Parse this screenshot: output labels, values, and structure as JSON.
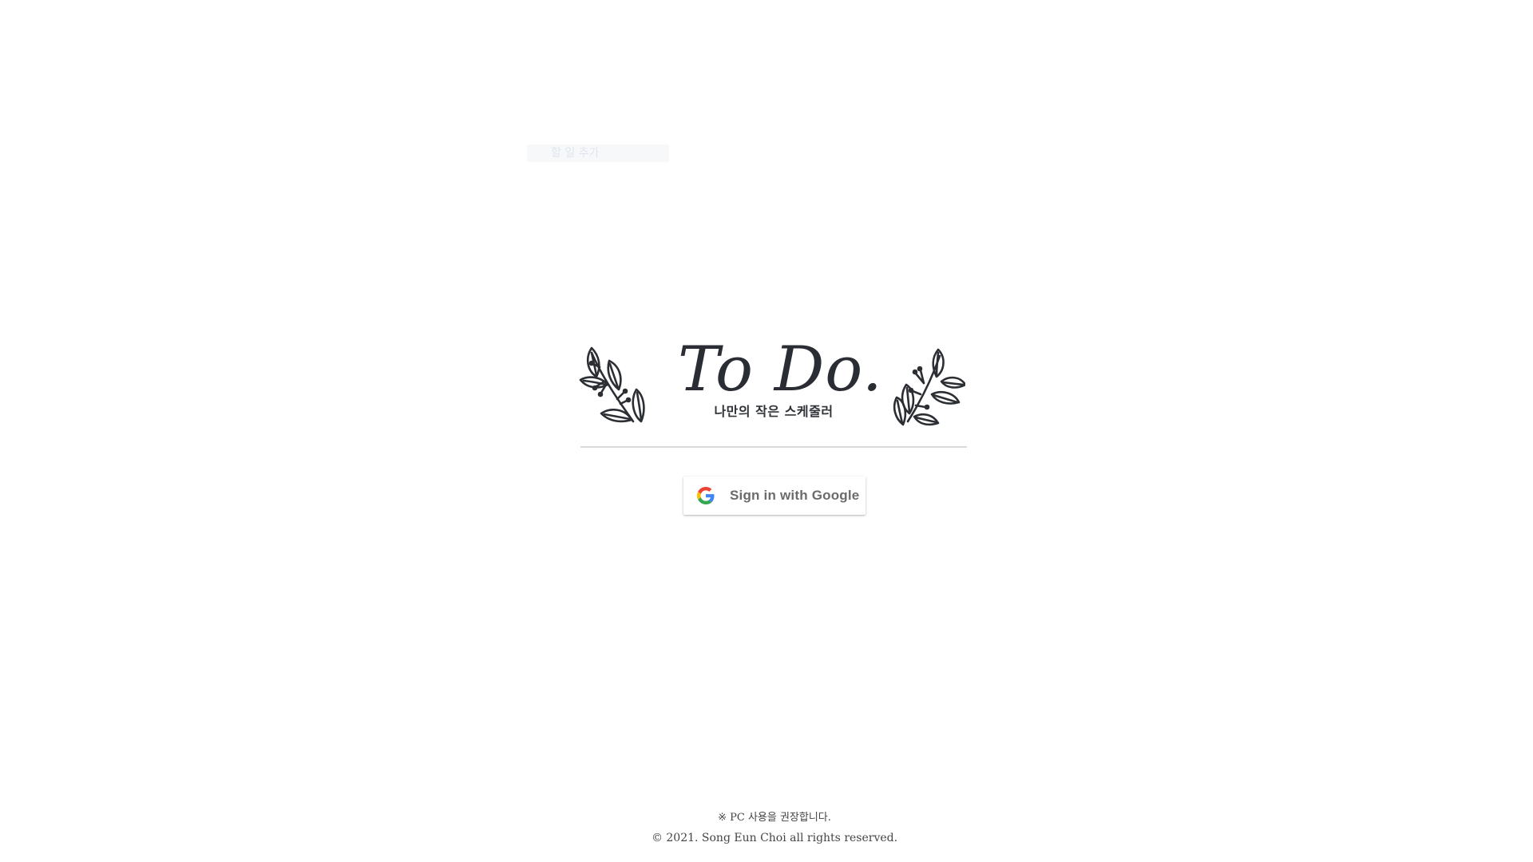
{
  "toast": {
    "text": "할 일 추가"
  },
  "hero": {
    "title": "To Do.",
    "subtitle": "나만의 작은 스케줄러",
    "left_decoration_icon": "leaf-branch-icon",
    "right_decoration_icon": "leaf-branch-icon"
  },
  "signin": {
    "label": "Sign in with Google",
    "icon": "google-g-icon",
    "colors": {
      "blue": "#4285F4",
      "red": "#EA4335",
      "yellow": "#FBBC05",
      "green": "#34A853"
    }
  },
  "footer": {
    "note": "※ PC 사용을 권장합니다.",
    "copyright": "© 2021. Song Eun Choi all rights reserved."
  }
}
